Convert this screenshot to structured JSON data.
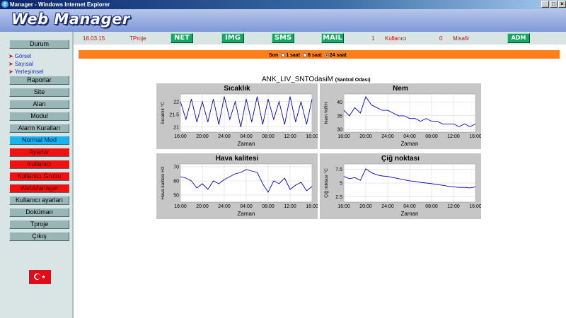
{
  "window": {
    "title": "Manager - Windows Internet Explorer"
  },
  "app": {
    "logo": "Web Manager"
  },
  "sidebar": {
    "items": [
      {
        "label": "Durum",
        "style": "normal"
      },
      {
        "label": "Raporlar",
        "style": "normal"
      },
      {
        "label": "Site",
        "style": "normal"
      },
      {
        "label": "Alan",
        "style": "normal"
      },
      {
        "label": "Modul",
        "style": "normal"
      },
      {
        "label": "Alarm Kuralları",
        "style": "normal"
      },
      {
        "label": "Normal Mod",
        "style": "blue"
      },
      {
        "label": "Ayarlar",
        "style": "red"
      },
      {
        "label": "Kullanıcı",
        "style": "red"
      },
      {
        "label": "Kullanıcı Grubu",
        "style": "red"
      },
      {
        "label": "WebManager",
        "style": "red"
      },
      {
        "label": "Kullanıcı ayarları",
        "style": "normal"
      },
      {
        "label": "Doküman",
        "style": "normal"
      },
      {
        "label": "Tproje",
        "style": "normal"
      },
      {
        "label": "Çıkış",
        "style": "normal"
      }
    ],
    "sublinks": [
      "Görsel",
      "Sayısal",
      "Yerleşimsel"
    ]
  },
  "topbar": {
    "date": "16.03.15",
    "project": "TProje",
    "buttons": [
      "NET",
      "IMG",
      "SMS",
      "MAIL"
    ],
    "users_count": "1",
    "users_label": "Kullanıcı",
    "guests_count": "0",
    "guests_label": "Misafir",
    "admin_button": "ADM"
  },
  "range_selector": {
    "label": "Son",
    "options": [
      "1 saat",
      "8 saat",
      "24 saat"
    ],
    "selected": "24 saat"
  },
  "sensor": {
    "name": "ANK_LIV_SNTOdasiM",
    "location": "(Santral Odası)"
  },
  "colors": {
    "accent_orange": "#ff7f1a",
    "series_blue": "#0000cc",
    "nav_red": "#f21111",
    "nav_blue": "#18b4f0"
  },
  "chart_data": [
    {
      "type": "line",
      "title": "Sıcaklık",
      "xlabel": "Zaman",
      "ylabel": "Sıcaklık °C",
      "x_ticks": [
        "16:00",
        "20:00",
        "24:00",
        "04:00",
        "08:00",
        "12:00",
        "16:00"
      ],
      "y_ticks": [
        21,
        21.5,
        22
      ],
      "ylim": [
        20.8,
        22.3
      ],
      "x": [
        0,
        1,
        2,
        3,
        4,
        5,
        6,
        7,
        8,
        9,
        10,
        11,
        12,
        13,
        14,
        15,
        16,
        17,
        18,
        19,
        20,
        21,
        22,
        23,
        24
      ],
      "values": [
        22.0,
        21.3,
        22.1,
        21.2,
        22.0,
        21.2,
        22.1,
        21.1,
        22.2,
        21.3,
        22.0,
        21.0,
        22.1,
        21.2,
        22.2,
        21.1,
        22.1,
        21.3,
        22.0,
        21.1,
        22.2,
        21.2,
        22.0,
        21.1,
        22.1
      ]
    },
    {
      "type": "line",
      "title": "Nem",
      "xlabel": "Zaman",
      "ylabel": "Nem %RH",
      "x_ticks": [
        "16:00",
        "20:00",
        "24:00",
        "04:00",
        "08:00",
        "12:00",
        "16:00"
      ],
      "y_ticks": [
        30,
        35,
        40
      ],
      "ylim": [
        29,
        43
      ],
      "x": [
        0,
        1,
        2,
        3,
        4,
        5,
        6,
        7,
        8,
        9,
        10,
        11,
        12,
        13,
        14,
        15,
        16,
        17,
        18,
        19,
        20,
        21,
        22,
        23,
        24
      ],
      "values": [
        37,
        35,
        38,
        36,
        42,
        39,
        38,
        37,
        37,
        36,
        35,
        35,
        34,
        34,
        33,
        34,
        33,
        33,
        32,
        32,
        32,
        31,
        32,
        31,
        32
      ]
    },
    {
      "type": "line",
      "title": "Hava kalitesi",
      "xlabel": "Zaman",
      "ylabel": "Hava kalitesi H2",
      "x_ticks": [
        "16:00",
        "20:00",
        "24:00",
        "04:00",
        "08:00",
        "12:00",
        "16:00"
      ],
      "y_ticks": [
        50,
        60,
        70
      ],
      "ylim": [
        45,
        72
      ],
      "x": [
        0,
        1,
        2,
        3,
        4,
        5,
        6,
        7,
        8,
        9,
        10,
        11,
        12,
        13,
        14,
        15,
        16,
        17,
        18,
        19,
        20,
        21,
        22,
        23,
        24
      ],
      "values": [
        63,
        62,
        60,
        55,
        58,
        54,
        60,
        58,
        61,
        63,
        65,
        66,
        68,
        67,
        66,
        58,
        52,
        60,
        58,
        62,
        54,
        57,
        59,
        53,
        56
      ]
    },
    {
      "type": "line",
      "title": "Çiğ noktası",
      "xlabel": "Zaman",
      "ylabel": "Çiğ noktası °C",
      "x_ticks": [
        "16:00",
        "20:00",
        "24:00",
        "04:00",
        "08:00",
        "12:00",
        "16:00"
      ],
      "y_ticks": [
        2.5,
        5,
        7.5
      ],
      "ylim": [
        1.5,
        8.5
      ],
      "x": [
        0,
        1,
        2,
        3,
        4,
        5,
        6,
        7,
        8,
        9,
        10,
        11,
        12,
        13,
        14,
        15,
        16,
        17,
        18,
        19,
        20,
        21,
        22,
        23,
        24
      ],
      "values": [
        6.2,
        5.8,
        6.0,
        5.5,
        7.6,
        6.9,
        6.5,
        6.3,
        6.2,
        6.0,
        5.8,
        5.6,
        5.4,
        5.3,
        5.1,
        5.0,
        4.9,
        4.7,
        4.6,
        4.4,
        4.3,
        4.2,
        4.2,
        4.1,
        4.3
      ]
    }
  ]
}
